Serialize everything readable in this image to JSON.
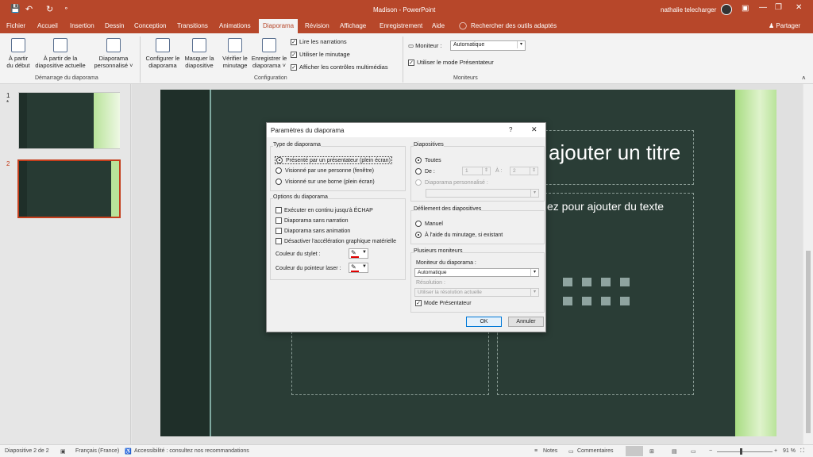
{
  "app": {
    "doc_name": "Madison",
    "separator": "-",
    "app_name": "PowerPoint",
    "user": "nathalie telecharger",
    "share": "Partager",
    "search": "Rechercher des outils adaptés"
  },
  "tabs": [
    "Fichier",
    "Accueil",
    "Insertion",
    "Dessin",
    "Conception",
    "Transitions",
    "Animations",
    "Diaporama",
    "Révision",
    "Affichage",
    "Enregistrement",
    "Aide"
  ],
  "ribbon": {
    "start": {
      "from_begin": [
        "À partir",
        "du début"
      ],
      "from_current": [
        "À partir de la",
        "diapositive actuelle"
      ],
      "custom": [
        "Diaporama",
        "personnalisé ˅"
      ],
      "group": "Démarrage du diaporama"
    },
    "config": {
      "setup": [
        "Configurer le",
        "diaporama"
      ],
      "hide": [
        "Masquer la",
        "diapositive"
      ],
      "rehearse": [
        "Vérifier le",
        "minutage"
      ],
      "record": [
        "Enregistrer le",
        "diaporama ˅"
      ],
      "narrations": "Lire les narrations",
      "timing": "Utiliser le minutage",
      "media": "Afficher les contrôles multimédias",
      "group": "Configuration"
    },
    "monitors": {
      "monitor_label": "Moniteur :",
      "monitor_value": "Automatique",
      "presenter": "Utiliser le mode Présentateur",
      "group": "Moniteurs"
    }
  },
  "thumbs": [
    {
      "num": "1",
      "star": "*"
    },
    {
      "num": "2"
    }
  ],
  "slide": {
    "title_text": "ajouter un titre",
    "body_text": "ez pour ajouter du texte"
  },
  "dialog": {
    "title": "Paramètres du diaporama",
    "help": "?",
    "close": "✕",
    "type": {
      "label": "Type de diaporama",
      "options": [
        "Présenté par un présentateur (plein écran)",
        "Visionné par une personne (fenêtre)",
        "Visionné sur une borne (plein écran)"
      ]
    },
    "options": {
      "label": "Options du diaporama",
      "items": [
        "Exécuter en continu jusqu'à ÉCHAP",
        "Diaporama sans narration",
        "Diaporama sans animation",
        "Désactiver l'accélération graphique matérielle"
      ],
      "pen": "Couleur du stylet :",
      "laser": "Couleur du pointeur laser :"
    },
    "slides": {
      "label": "Diapositives",
      "all": "Toutes",
      "from": "De :",
      "from_val": "1",
      "to": "À :",
      "to_val": "2",
      "custom": "Diaporama personnalisé :"
    },
    "advance": {
      "label": "Défilement des diapositives",
      "manual": "Manuel",
      "timing": "À l'aide du minutage, si existant"
    },
    "monitors": {
      "label": "Plusieurs moniteurs",
      "monitor": "Moniteur du diaporama :",
      "monitor_val": "Automatique",
      "resolution": "Résolution :",
      "resolution_val": "Utiliser la résolution actuelle",
      "presenter": "Mode Présentateur"
    },
    "ok": "OK",
    "cancel": "Annuler"
  },
  "status": {
    "slide": "Diapositive 2 de 2",
    "lang": "Français (France)",
    "access": "Accessibilité : consultez nos recommandations",
    "notes": "Notes",
    "comments": "Commentaires",
    "zoom": "91 %"
  }
}
